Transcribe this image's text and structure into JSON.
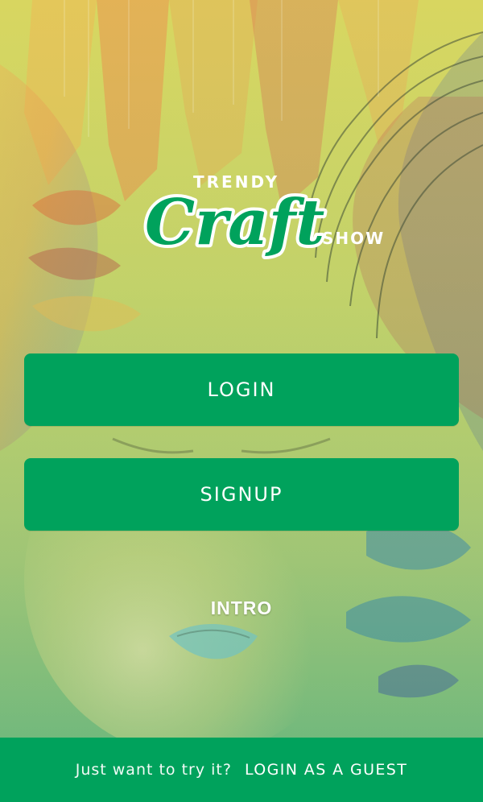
{
  "colors": {
    "accent_green": "#00a25c",
    "text_white": "#ffffff"
  },
  "logo": {
    "line1": "TRENDY",
    "line2": "Craft",
    "line3": "SHOW"
  },
  "buttons": {
    "login_label": "LOGIN",
    "signup_label": "SIGNUP"
  },
  "intro": {
    "label": "INTRO"
  },
  "footer": {
    "prompt": "Just want to try it?",
    "guest_label": "LOGIN AS A GUEST"
  },
  "icons": {
    "logo": "trendy-craft-show-logo"
  }
}
